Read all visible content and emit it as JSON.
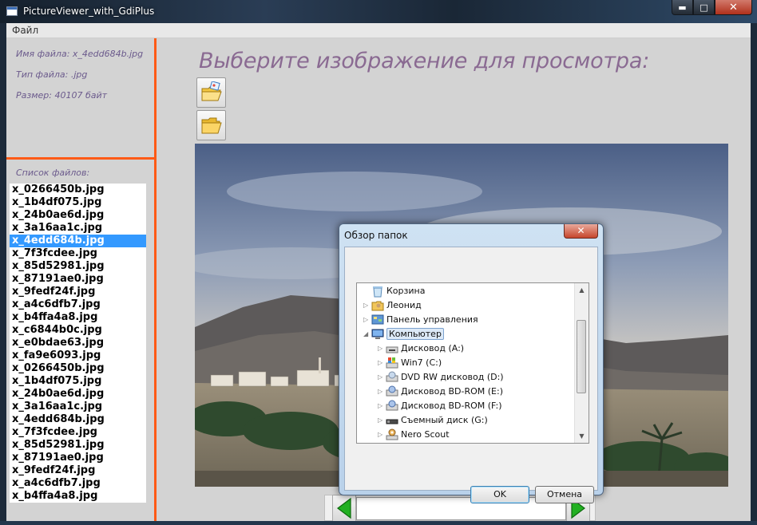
{
  "window": {
    "title": "PictureViewer_with_GdiPlus",
    "min_glyph": "▬",
    "max_glyph": "□",
    "close_glyph": "✕"
  },
  "menu": {
    "file": "Файл"
  },
  "info": {
    "file_name": "Имя файла: x_4edd684b.jpg",
    "file_type": "Тип файла: .jpg",
    "file_size": "Размер: 40107 байт"
  },
  "file_list": {
    "label": "Список файлов:",
    "selected_index": 4,
    "items": [
      "x_0266450b.jpg",
      "x_1b4df075.jpg",
      "x_24b0ae6d.jpg",
      "x_3a16aa1c.jpg",
      "x_4edd684b.jpg",
      "x_7f3fcdee.jpg",
      "x_85d52981.jpg",
      "x_87191ae0.jpg",
      "x_9fedf24f.jpg",
      "x_a4c6dfb7.jpg",
      "x_b4ffa4a8.jpg",
      "x_c6844b0c.jpg",
      "x_e0bdae63.jpg",
      "x_fa9e6093.jpg",
      "x_0266450b.jpg",
      "x_1b4df075.jpg",
      "x_24b0ae6d.jpg",
      "x_3a16aa1c.jpg",
      "x_4edd684b.jpg",
      "x_7f3fcdee.jpg",
      "x_85d52981.jpg",
      "x_87191ae0.jpg",
      "x_9fedf24f.jpg",
      "x_a4c6dfb7.jpg",
      "x_b4ffa4a8.jpg"
    ]
  },
  "main": {
    "heading": "Выберите изображение для просмотра:",
    "toolbar": [
      {
        "icon": "open-picture-folder-icon"
      },
      {
        "icon": "open-folder-icon"
      }
    ],
    "nav": {
      "prev_icon": "arrow-left-icon",
      "next_icon": "arrow-right-icon"
    }
  },
  "dialog": {
    "title": "Обзор папок",
    "close_glyph": "✕",
    "tree": [
      {
        "label": "Корзина",
        "icon": "recycle-bin-icon",
        "level": 0,
        "expander": "",
        "selected": false
      },
      {
        "label": "Леонид",
        "icon": "user-folder-icon",
        "level": 0,
        "expander": "▷",
        "selected": false
      },
      {
        "label": "Панель управления",
        "icon": "control-panel-icon",
        "level": 0,
        "expander": "▷",
        "selected": false
      },
      {
        "label": "Компьютер",
        "icon": "computer-icon",
        "level": 0,
        "expander": "◢",
        "selected": true
      },
      {
        "label": "Дисковод (A:)",
        "icon": "floppy-drive-icon",
        "level": 1,
        "expander": "▷",
        "selected": false
      },
      {
        "label": "Win7 (C:)",
        "icon": "windows-drive-icon",
        "level": 1,
        "expander": "▷",
        "selected": false
      },
      {
        "label": "DVD RW дисковод (D:)",
        "icon": "dvd-drive-icon",
        "level": 1,
        "expander": "▷",
        "selected": false
      },
      {
        "label": "Дисковод BD-ROM (E:)",
        "icon": "bd-drive-icon",
        "level": 1,
        "expander": "▷",
        "selected": false
      },
      {
        "label": "Дисковод BD-ROM (F:)",
        "icon": "bd-drive-icon",
        "level": 1,
        "expander": "▷",
        "selected": false
      },
      {
        "label": "Съемный диск (G:)",
        "icon": "removable-drive-icon",
        "level": 1,
        "expander": "▷",
        "selected": false
      },
      {
        "label": "Nero Scout",
        "icon": "nero-scout-icon",
        "level": 1,
        "expander": "▷",
        "selected": false
      }
    ],
    "ok_label": "OK",
    "cancel_label": "Отмена"
  },
  "colors": {
    "divider": "#ff5a16",
    "selection": "#3399ff",
    "heading": "#8a6a92",
    "info_text": "#6b5a8c"
  }
}
